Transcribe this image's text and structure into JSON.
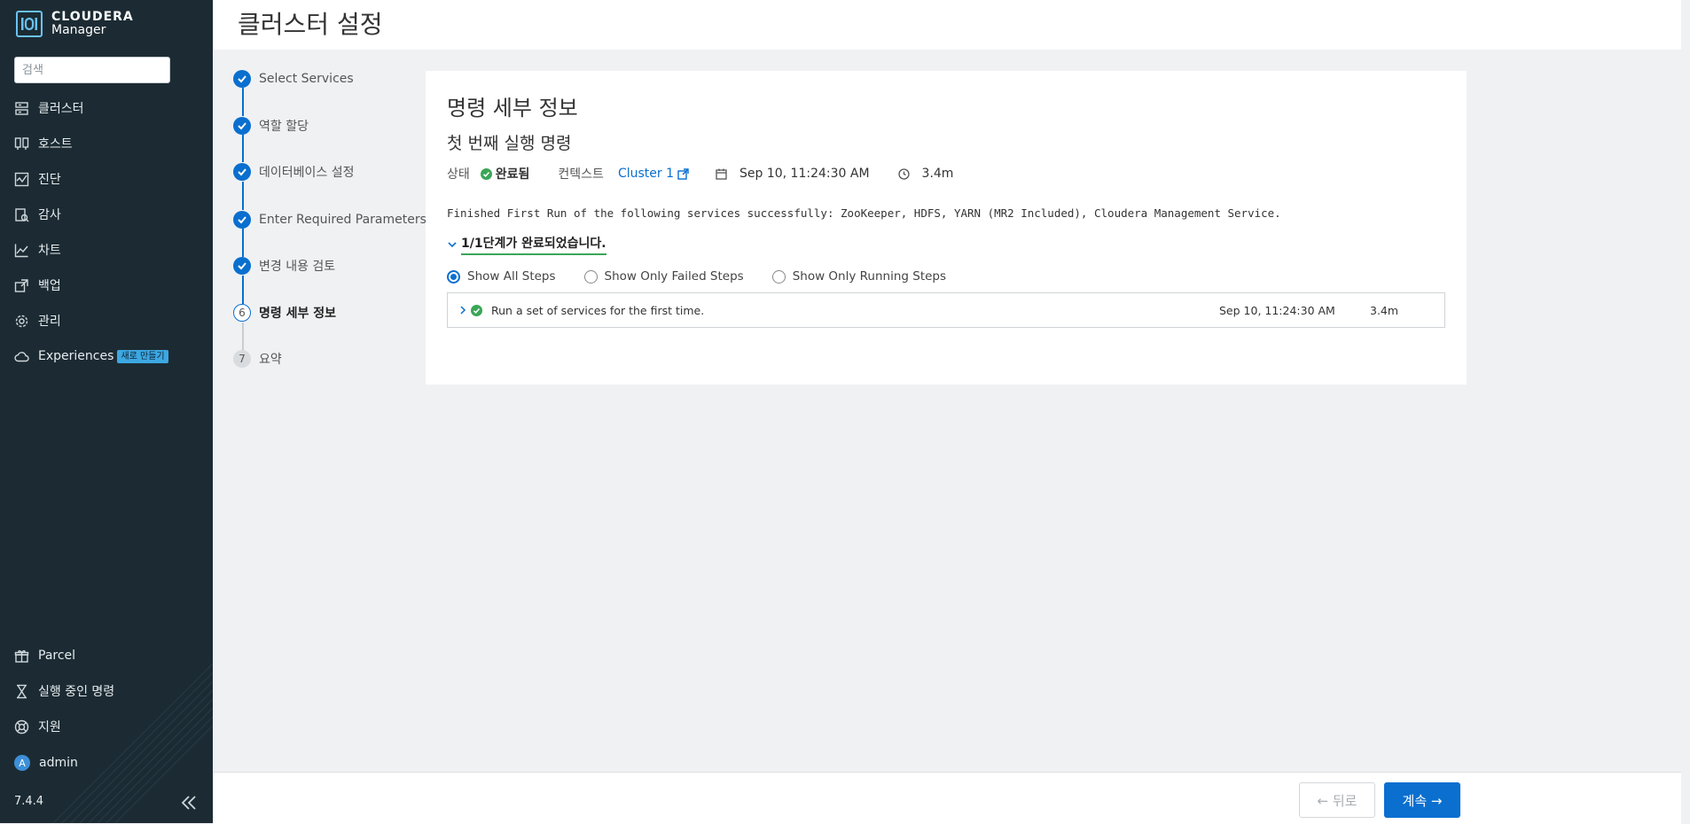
{
  "brand": {
    "line1": "CLOUDERA",
    "line2": "Manager"
  },
  "sidebar": {
    "search_placeholder": "검색",
    "nav": [
      {
        "label": "클러스터",
        "icon": "cluster-icon"
      },
      {
        "label": "호스트",
        "icon": "hosts-icon"
      },
      {
        "label": "진단",
        "icon": "diagnostics-icon"
      },
      {
        "label": "감사",
        "icon": "audit-icon"
      },
      {
        "label": "차트",
        "icon": "chart-icon"
      },
      {
        "label": "백업",
        "icon": "backup-icon"
      },
      {
        "label": "관리",
        "icon": "gear-icon"
      },
      {
        "label": "Experiences",
        "icon": "cloud-icon",
        "badge": "새로 만들기"
      }
    ],
    "bottom": [
      {
        "label": "Parcel",
        "icon": "gift-icon"
      },
      {
        "label": "실행 중인 명령",
        "icon": "hourglass-icon"
      },
      {
        "label": "지원",
        "icon": "support-icon"
      },
      {
        "label": "admin",
        "icon": "avatar",
        "avatar_letter": "A"
      }
    ],
    "version": "7.4.4"
  },
  "header": {
    "title": "클러스터 설정"
  },
  "wizard": {
    "steps": [
      {
        "label": "Select Services",
        "state": "done"
      },
      {
        "label": "역할 할당",
        "state": "done"
      },
      {
        "label": "데이터베이스 설정",
        "state": "done"
      },
      {
        "label": "Enter Required Parameters",
        "state": "done"
      },
      {
        "label": "변경 내용 검토",
        "state": "done"
      },
      {
        "label": "명령 세부 정보",
        "state": "current",
        "number": "6"
      },
      {
        "label": "요약",
        "state": "future",
        "number": "7"
      }
    ]
  },
  "command": {
    "heading": "명령 세부 정보",
    "subheading": "첫 번째 실행 명령",
    "status_label": "상태",
    "status_value": "완료됨",
    "context_label": "컨텍스트",
    "context_value": "Cluster 1",
    "date": "Sep 10, 11:24:30 AM",
    "duration": "3.4m",
    "message": "Finished First Run of the following services successfully: ZooKeeper, HDFS, YARN (MR2 Included), Cloudera Management Service.",
    "summary": "1/1단계가 완료되었습니다.",
    "filters": [
      {
        "label": "Show All Steps",
        "checked": true
      },
      {
        "label": "Show Only Failed Steps",
        "checked": false
      },
      {
        "label": "Show Only Running Steps",
        "checked": false
      }
    ],
    "steps": [
      {
        "description": "Run a set of services for the first time.",
        "time": "Sep 10, 11:24:30 AM",
        "duration": "3.4m"
      }
    ]
  },
  "footer": {
    "back_label": "← 뒤로",
    "next_label": "계속 →"
  },
  "colors": {
    "sidebar_bg": "#1c2b33",
    "accent": "#0a6fcf",
    "success": "#3aa657"
  }
}
